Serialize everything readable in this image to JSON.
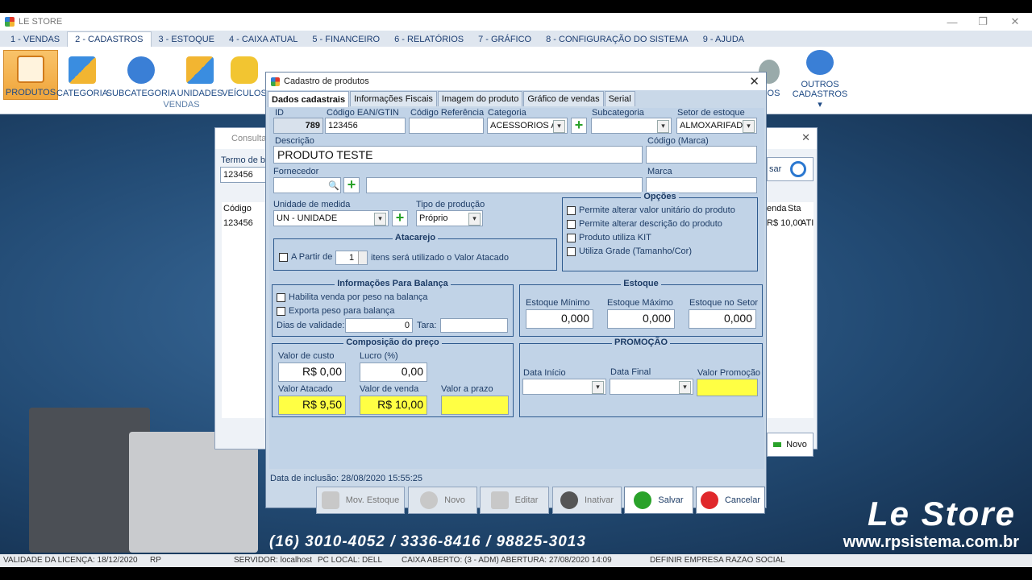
{
  "app": {
    "title": "LE STORE"
  },
  "menu": [
    "1 - VENDAS",
    "2 - CADASTROS",
    "3 - ESTOQUE",
    "4 - CAIXA ATUAL",
    "5 - FINANCEIRO",
    "6 - RELATÓRIOS",
    "7 - GRÁFICO",
    "8 - CONFIGURAÇÃO DO SISTEMA",
    "9 - AJUDA"
  ],
  "ribbon": {
    "produtos": "PRODUTOS",
    "categoria": "CATEGORIA",
    "subcategoria": "SUBCATEGORIA",
    "unidades": "UNIDADES",
    "veiculos": "VEÍCULOS",
    "group_vendas": "VENDAS",
    "rios": "RIOS",
    "outros": "OUTROS",
    "cadastros": "CADASTROS ▾"
  },
  "backwin": {
    "title": "Consulta",
    "termo": "Termo de b",
    "search_value": "123456",
    "col_codigo": "Código",
    "row_codigo": "123456",
    "col_venda": "enda",
    "col_sta": "Sta",
    "row_venda": "R$ 10,00",
    "row_sta": "ATI",
    "search_btn": "sar",
    "novo": "Novo"
  },
  "dialog": {
    "title": "Cadastro de produtos",
    "tabs": [
      "Dados cadastrais",
      "Informações Fiscais",
      "Imagem do produto",
      "Gráfico de vendas",
      "Serial"
    ],
    "labels": {
      "id": "ID",
      "ean": "Código EAN/GTIN",
      "ref": "Código Referência",
      "categoria": "Categoria",
      "subcategoria": "Subcategoria",
      "setor": "Setor de estoque",
      "descricao": "Descrição",
      "codigo_marca": "Código (Marca)",
      "fornecedor": "Fornecedor",
      "marca": "Marca",
      "unidade": "Unidade de medida",
      "tipo_producao": "Tipo de produção"
    },
    "values": {
      "id": "789",
      "ean": "123456",
      "ref": "",
      "categoria": "ACESSORIOS AD",
      "subcategoria": "",
      "setor": "ALMOXARIFADO",
      "descricao": "PRODUTO TESTE",
      "codigo_marca": "",
      "fornecedor": "",
      "fornecedor_nome": "",
      "marca": "",
      "unidade": "UN - UNIDADE",
      "tipo_producao": "Próprio"
    },
    "opcoes": {
      "title": "Opções",
      "items": [
        "Permite alterar valor unitário do produto",
        "Permite alterar descrição do produto",
        "Produto utiliza KIT",
        "Utiliza Grade (Tamanho/Cor)"
      ]
    },
    "atacarejo": {
      "title": "Atacarejo",
      "a_partir": "A Partir de",
      "qty": "1",
      "suffix": "itens será utilizado o Valor Atacado"
    },
    "balanca": {
      "title": "Informações Para Balança",
      "habilita": "Habilita venda por peso na balança",
      "exporta": "Exporta peso para balança",
      "dias": "Dias de validade:",
      "dias_val": "0",
      "tara": "Tara:",
      "tara_val": ""
    },
    "estoque": {
      "title": "Estoque",
      "min": "Estoque Mínimo",
      "max": "Estoque Máximo",
      "setor": "Estoque no Setor",
      "min_val": "0,000",
      "max_val": "0,000",
      "setor_val": "0,000"
    },
    "preco": {
      "title": "Composição do preço",
      "custo": "Valor de custo",
      "lucro": "Lucro (%)",
      "atacado": "Valor Atacado",
      "venda": "Valor de venda",
      "prazo": "Valor a prazo",
      "custo_val": "R$ 0,00",
      "lucro_val": "0,00",
      "atacado_val": "R$ 9,50",
      "venda_val": "R$ 10,00",
      "prazo_val": ""
    },
    "promocao": {
      "title": "PROMOÇÃO",
      "inicio": "Data Início",
      "final": "Data Final",
      "valor": "Valor Promoção"
    },
    "inclusao": "Data de inclusão: 28/08/2020 15:55:25",
    "buttons": {
      "mov": "Mov. Estoque",
      "novo": "Novo",
      "editar": "Editar",
      "inativar": "Inativar",
      "salvar": "Salvar",
      "cancelar": "Cancelar"
    }
  },
  "brand": {
    "name": "Le Store",
    "site": "www.rpsistema.com.br",
    "phones": "(16) 3010-4052 / 3336-8416 / 98825-3013"
  },
  "status": {
    "licenca": "VALIDADE DA LICENÇA: 18/12/2020",
    "rp": "RP",
    "servidor": "SERVIDOR: localhost",
    "pc": "PC LOCAL: DELL",
    "caixa": "CAIXA ABERTO: (3 - ADM) ABERTURA: 27/08/2020 14:09",
    "empresa": "DEFINIR EMPRESA RAZAO SOCIAL"
  }
}
